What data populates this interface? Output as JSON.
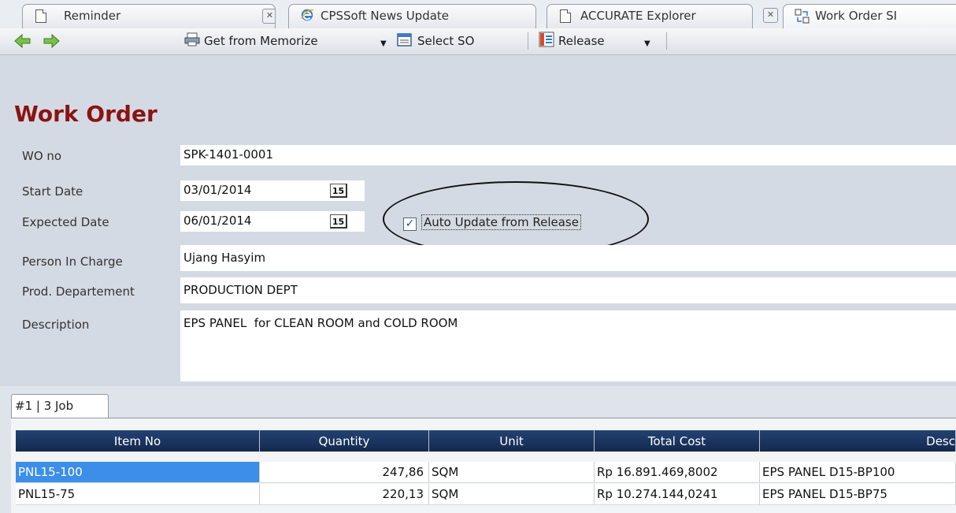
{
  "tabs": [
    {
      "label": "Reminder",
      "icon": "document-icon"
    },
    {
      "label": "CPSSoft News Update",
      "icon": "browser-icon"
    },
    {
      "label": "ACCURATE Explorer",
      "icon": "document-icon"
    },
    {
      "label": "Work Order SI",
      "icon": "work-order-icon"
    }
  ],
  "toolbar": {
    "get_from_memorize": "Get from Memorize",
    "select_so": "Select SO",
    "release": "Release"
  },
  "form": {
    "title": "Work Order",
    "wo_no_label": "WO no",
    "wo_no": "SPK-1401-0001",
    "start_date_label": "Start Date",
    "start_date": "03/01/2014",
    "expected_date_label": "Expected Date",
    "expected_date": "06/01/2014",
    "calendar_glyph": "15",
    "auto_update_label": "Auto Update from Release",
    "auto_update_checked": true,
    "person_label": "Person In Charge",
    "person": "Ujang Hasyim",
    "dept_label": "Prod. Departement",
    "dept": "PRODUCTION DEPT",
    "description_label": "Description",
    "description": "EPS PANEL  for CLEAN ROOM and COLD ROOM"
  },
  "job_tab": "#1 | 3 Job",
  "grid": {
    "columns": [
      "Item No",
      "Quantity",
      "Unit",
      "Total Cost",
      "Desc"
    ],
    "rows": [
      {
        "item": "PNL15-100",
        "qty": "247,86",
        "unit": "SQM",
        "cost": "Rp 16.891.469,8002",
        "desc": "EPS PANEL D15-BP100"
      },
      {
        "item": "PNL15-75",
        "qty": "220,13",
        "unit": "SQM",
        "cost": "Rp 10.274.144,0241",
        "desc": "EPS PANEL D15-BP75"
      }
    ]
  },
  "colors": {
    "title": "#8b1313",
    "header": "#1b335c",
    "selected": "#3c8ee8",
    "background": "#d4dae3"
  }
}
